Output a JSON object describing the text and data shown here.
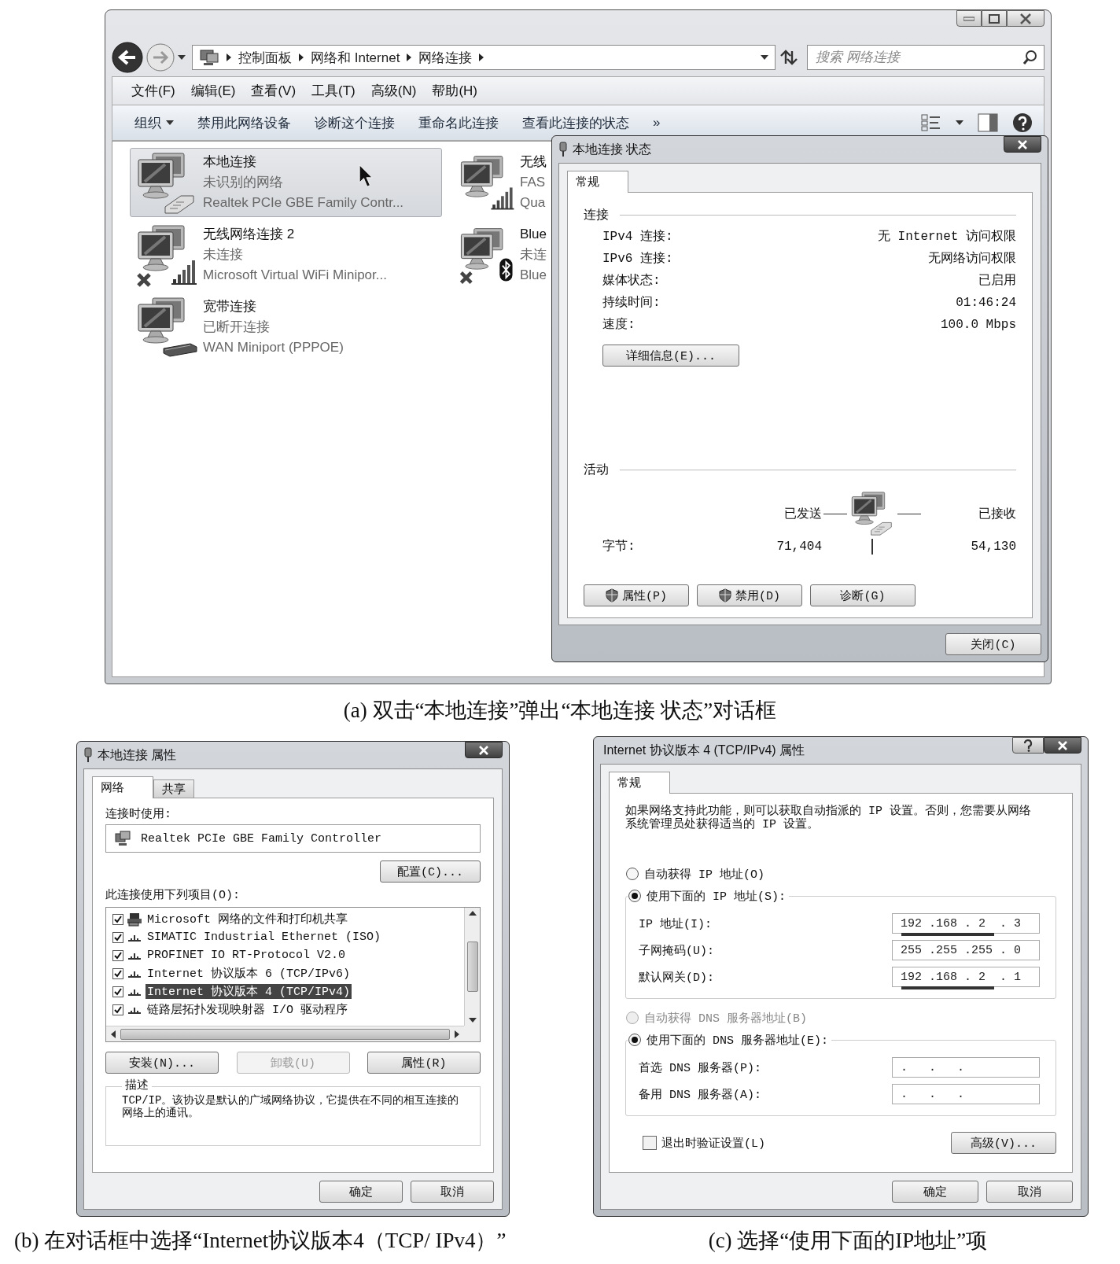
{
  "explorer": {
    "address": [
      "控制面板",
      "网络和 Internet",
      "网络连接"
    ],
    "search": {
      "placeholder": "搜索 网络连接"
    },
    "menu": [
      "文件(F)",
      "编辑(E)",
      "查看(V)",
      "工具(T)",
      "高级(N)",
      "帮助(H)"
    ],
    "toolbar": [
      {
        "label": "组织",
        "kind": "dropdown"
      },
      {
        "label": "禁用此网络设备",
        "kind": "plain"
      },
      {
        "label": "诊断这个连接",
        "kind": "plain"
      },
      {
        "label": "重命名此连接",
        "kind": "plain"
      },
      {
        "label": "查看此连接的状态",
        "kind": "plain"
      },
      {
        "label": "»",
        "kind": "overflow"
      }
    ],
    "connections": [
      {
        "name": "本地连接",
        "status": "未识别的网络",
        "device": "Realtek PCIe GBE Family Contr...",
        "kind": "wired",
        "selected": true,
        "crossed": false
      },
      {
        "name": "无线",
        "status": "FAS",
        "device": "Qua",
        "kind": "wifi",
        "selected": false,
        "crossed": false
      },
      {
        "name": "无线网络连接 2",
        "status": "未连接",
        "device": "Microsoft Virtual WiFi Minipor...",
        "kind": "wifi",
        "selected": false,
        "crossed": true
      },
      {
        "name": "Blue",
        "status": "未连",
        "device": "Blue",
        "kind": "bluetooth",
        "selected": false,
        "crossed": true
      },
      {
        "name": "宽带连接",
        "status": "已断开连接",
        "device": "WAN Miniport (PPPOE)",
        "kind": "wan",
        "selected": false,
        "crossed": false
      }
    ]
  },
  "status_dialog": {
    "title": "本地连接 状态",
    "tabs": [
      {
        "label": "常规",
        "selected": true
      }
    ],
    "connection_header": "连接",
    "rows": [
      {
        "label": "IPv4 连接:",
        "value": "无 Internet 访问权限"
      },
      {
        "label": "IPv6 连接:",
        "value": "无网络访问权限"
      },
      {
        "label": "媒体状态:",
        "value": "已启用"
      },
      {
        "label": "持续时间:",
        "value": "01:46:24"
      },
      {
        "label": "速度:",
        "value": "100.0 Mbps"
      }
    ],
    "details_button": "详细信息(E)...",
    "activity_header": "活动",
    "sent_label": "已发送",
    "received_label": "已接收",
    "bytes_label": "字节:",
    "bytes_sent": "71,404",
    "bytes_received": "54,130",
    "buttons": [
      {
        "label": "属性(P)",
        "kind": "shield"
      },
      {
        "label": "禁用(D)",
        "kind": "shield"
      },
      {
        "label": "诊断(G)",
        "kind": "plain"
      }
    ],
    "close_button": "关闭(C)"
  },
  "properties_dialog": {
    "title": "本地连接 属性",
    "tabs": [
      {
        "label": "网络",
        "selected": true
      },
      {
        "label": "共享",
        "selected": false
      }
    ],
    "connect_using_label": "连接时使用:",
    "adapter": "Realtek PCIe GBE Family Controller",
    "configure_button": "配置(C)...",
    "items_label": "此连接使用下列项目(O):",
    "items": [
      {
        "label": "Microsoft 网络的文件和打印机共享",
        "kind": "service",
        "checked": true,
        "selected": false
      },
      {
        "label": "SIMATIC Industrial Ethernet (ISO)",
        "kind": "protocol",
        "checked": true,
        "selected": false
      },
      {
        "label": "PROFINET IO RT-Protocol V2.0",
        "kind": "protocol",
        "checked": true,
        "selected": false
      },
      {
        "label": "Internet 协议版本 6 (TCP/IPv6)",
        "kind": "protocol",
        "checked": true,
        "selected": false
      },
      {
        "label": "Internet 协议版本 4 (TCP/IPv4)",
        "kind": "protocol",
        "checked": true,
        "selected": true
      },
      {
        "label": "链路层拓扑发现映射器 I/O 驱动程序",
        "kind": "protocol",
        "checked": true,
        "selected": false
      }
    ],
    "buttons": [
      {
        "label": "安装(N)...",
        "disabled": false
      },
      {
        "label": "卸载(U)",
        "disabled": true
      },
      {
        "label": "属性(R)",
        "disabled": false
      }
    ],
    "description_label": "描述",
    "description": "TCP/IP。该协议是默认的广域网络协议，它提供在不同的相互连接的网络上的通讯。",
    "ok_button": "确定",
    "cancel_button": "取消"
  },
  "ipv4_dialog": {
    "title": "Internet 协议版本 4 (TCP/IPv4) 属性",
    "tabs": [
      {
        "label": "常规",
        "selected": true
      }
    ],
    "intro": "如果网络支持此功能，则可以获取自动指派的 IP 设置。否则，您需要从网络系统管理员处获得适当的 IP 设置。",
    "ip_options": [
      {
        "label": "自动获得 IP 地址(O)",
        "selected": false,
        "disabled": false
      },
      {
        "label": "使用下面的 IP 地址(S):",
        "selected": true,
        "disabled": false
      }
    ],
    "ip_fields": [
      {
        "label": "IP 地址(I):",
        "value": "192 .168 . 2  . 3",
        "underlined": true
      },
      {
        "label": "子网掩码(U):",
        "value": "255 .255 .255 . 0",
        "underlined": false
      },
      {
        "label": "默认网关(D):",
        "value": "192 .168 . 2  . 1",
        "underlined": true
      }
    ],
    "dns_options": [
      {
        "label": "自动获得 DNS 服务器地址(B)",
        "selected": false,
        "disabled": true
      },
      {
        "label": "使用下面的 DNS 服务器地址(E):",
        "selected": true,
        "disabled": false
      }
    ],
    "dns_fields": [
      {
        "label": "首选 DNS 服务器(P):",
        "value": ".   .   .",
        "underlined": false
      },
      {
        "label": "备用 DNS 服务器(A):",
        "value": ".   .   .",
        "underlined": false
      }
    ],
    "validate_checkbox": {
      "label": "退出时验证设置(L)",
      "checked": false
    },
    "advanced_button": "高级(V)...",
    "ok_button": "确定",
    "cancel_button": "取消"
  },
  "captions": [
    "(a) 双击“本地连接”弹出“本地连接 状态”对话框",
    "(b) 在对话框中选择“Internet协议版本4（TCP/ IPv4）”",
    "(c) 选择“使用下面的IP地址”项"
  ]
}
